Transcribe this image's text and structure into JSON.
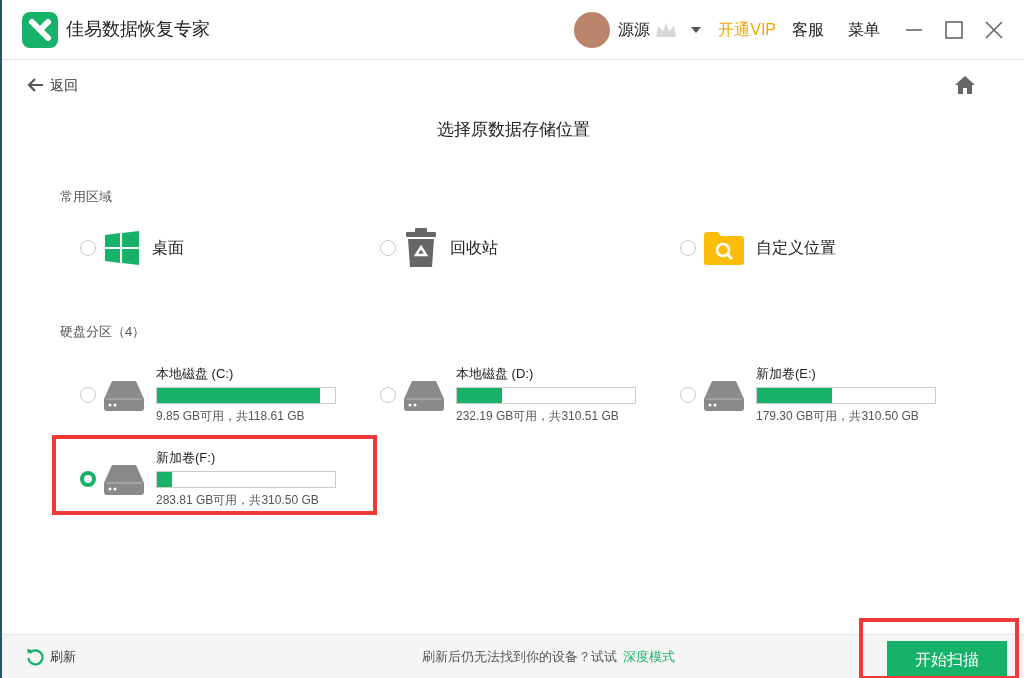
{
  "app": {
    "title": "佳易数据恢复专家"
  },
  "account": {
    "username": "源源",
    "vip_link": "开通VIP",
    "service": "客服",
    "menu": "菜单"
  },
  "nav": {
    "back": "返回"
  },
  "page_title": "选择原数据存储位置",
  "common": {
    "label": "常用区域",
    "items": [
      {
        "kind": "desktop",
        "label": "桌面",
        "selected": false
      },
      {
        "kind": "recycle",
        "label": "回收站",
        "selected": false
      },
      {
        "kind": "custom",
        "label": "自定义位置",
        "selected": false
      }
    ]
  },
  "drives": {
    "label": "硬盘分区（4）",
    "items": [
      {
        "name": "本地磁盘 (C:)",
        "level": 0.917,
        "info": "9.85 GB可用，共118.61 GB",
        "selected": false,
        "highlighted": false
      },
      {
        "name": "本地磁盘 (D:)",
        "level": 0.253,
        "info": "232.19 GB可用，共310.51 GB",
        "selected": false,
        "highlighted": false
      },
      {
        "name": "新加卷(E:)",
        "level": 0.423,
        "info": "179.30 GB可用，共310.50 GB",
        "selected": false,
        "highlighted": false
      },
      {
        "name": "新加卷(F:)",
        "level": 0.086,
        "info": "283.81 GB可用，共310.50 GB",
        "selected": true,
        "highlighted": true
      }
    ]
  },
  "footer": {
    "refresh": "刷新",
    "hint": "刷新后仍无法找到你的设备？试试",
    "deep_mode": "深度模式",
    "start": "开始扫描",
    "start_highlighted": true
  }
}
